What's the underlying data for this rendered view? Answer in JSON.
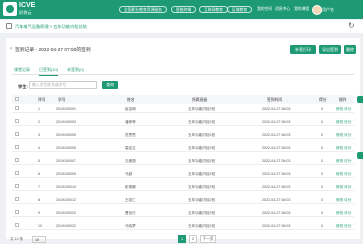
{
  "brand": {
    "name": "ICVE",
    "subtitle": "职教云"
  },
  "top_nav": {
    "pills": [
      "全国职业教育资源服务",
      "智能终端",
      "互联网教育",
      "区域教育"
    ],
    "links": [
      "我的空间",
      "消息中心",
      "我的课程"
    ],
    "username": "用户名"
  },
  "breadcrumb": "汽车电气设备原理 > 五年功能内检总结",
  "panel": {
    "title": "签到记录 - 2022-04-27 07:50的签到",
    "buttons": {
      "manual": "补签打印",
      "export": "导出签到",
      "delete": "删除"
    }
  },
  "tabs": [
    "课堂记录",
    "已签到(10)",
    "未签到(0)"
  ],
  "search": {
    "label": "学生:",
    "placeholder": "输入学生姓名或学号",
    "button": "查询"
  },
  "table": {
    "headers": [
      "序号",
      "学号",
      "姓名",
      "所属班级",
      "签到时间",
      "得分",
      "操作"
    ],
    "rows": [
      {
        "no": "1",
        "sid": "2019100001",
        "name": "赵佳琦",
        "class": "五年功能内检2班",
        "time": "2022-04-27 08:03",
        "score": "0",
        "action": "修改 评分"
      },
      {
        "no": "2",
        "sid": "2019100003",
        "name": "潘菲菲",
        "class": "五年功能内检2班",
        "time": "2022-04-27 08:03",
        "score": "0",
        "action": "修改 评分"
      },
      {
        "no": "3",
        "sid": "2019100005",
        "name": "范思思",
        "class": "五年功能内检2班",
        "time": "2022-04-27 08:03",
        "score": "0",
        "action": "修改 评分"
      },
      {
        "no": "4",
        "sid": "2019100005",
        "name": "高佳玉",
        "class": "五年功能内检2班",
        "time": "2022-04-27 08:03",
        "score": "0",
        "action": "修改 评分"
      },
      {
        "no": "5",
        "sid": "2019100007",
        "name": "孔雅丽",
        "class": "五年功能内检2班",
        "time": "2022-04-27 08:03",
        "score": "0",
        "action": "修改 评分"
      },
      {
        "no": "6",
        "sid": "2019100009",
        "name": "马越",
        "class": "五年功能内检2班",
        "time": "2022-04-27 08:03",
        "score": "0",
        "action": "修改 评分"
      },
      {
        "no": "7",
        "sid": "2019100010",
        "name": "彭丽娜",
        "class": "五年功能内检2班",
        "time": "2022-04-27 08:03",
        "score": "0",
        "action": "修改 评分"
      },
      {
        "no": "8",
        "sid": "2019100012",
        "name": "王若仁",
        "class": "五年功能内检2班",
        "time": "2022-04-27 08:03",
        "score": "0",
        "action": "修改 评分"
      },
      {
        "no": "9",
        "sid": "2019100020",
        "name": "曹佳行",
        "class": "五年功能内检2班",
        "time": "2022-04-27 08:03",
        "score": "0",
        "action": "修改 评分"
      },
      {
        "no": "10",
        "sid": "2019100022",
        "name": "马晓梦",
        "class": "五年功能内检2班",
        "time": "2022-04-27 08:03",
        "score": "0",
        "action": "修改 评分"
      }
    ]
  },
  "footer": {
    "total": "共 10 条",
    "page_size": "10",
    "pages": [
      "1",
      "2",
      "下一页"
    ]
  },
  "colors": {
    "accent": "#1d9a74"
  }
}
